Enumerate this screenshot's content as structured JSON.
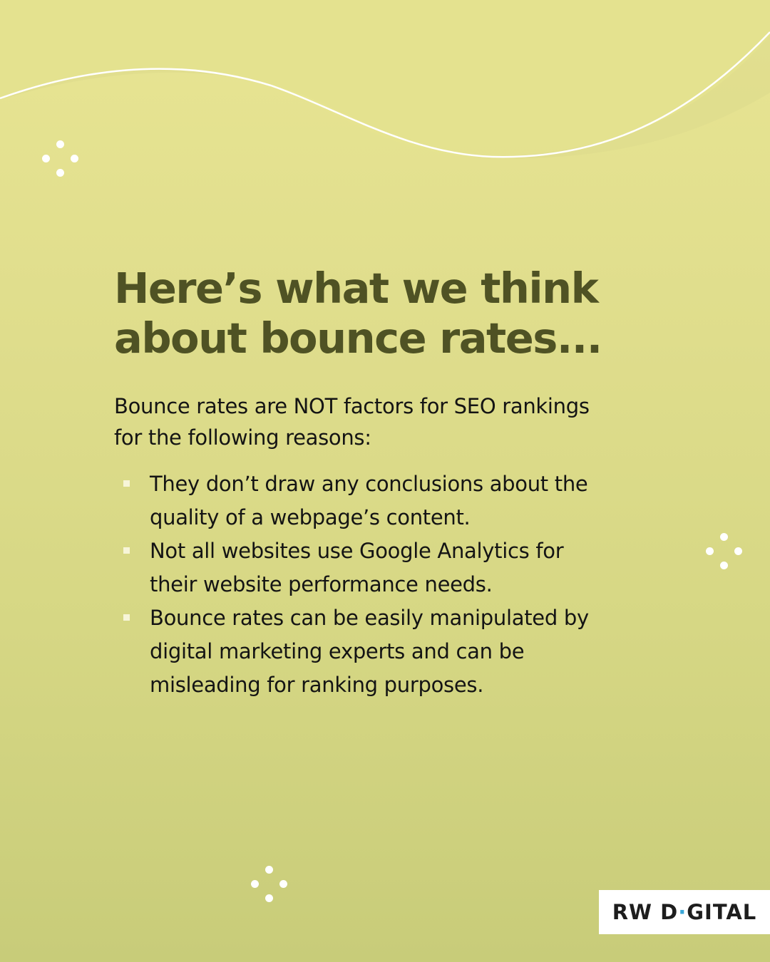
{
  "headline": {
    "line1": "Here’s what we think",
    "line2": "about bounce rates..."
  },
  "intro": {
    "line1": "Bounce rates are NOT factors for SEO rankings",
    "line2": "for the following reasons:"
  },
  "reasons": [
    {
      "line1": "They don’t draw any conclusions about the",
      "line2": "quality of a webpage’s content."
    },
    {
      "line1": "Not all websites use Google Analytics for",
      "line2": "their website performance needs."
    },
    {
      "line1": "Bounce rates can be easily manipulated by",
      "line2": "digital marketing experts and can be",
      "line3": "misleading for ranking purposes."
    }
  ],
  "brand": {
    "part1": "RW D",
    "accent": "·",
    "part2": "GITAL"
  },
  "colors": {
    "background_top": "#e8e593",
    "background_bottom": "#c8cc79",
    "headline": "#4f5224",
    "body_text": "#141414",
    "logo_accent": "#3aa7d8",
    "decoration": "#ffffff"
  }
}
